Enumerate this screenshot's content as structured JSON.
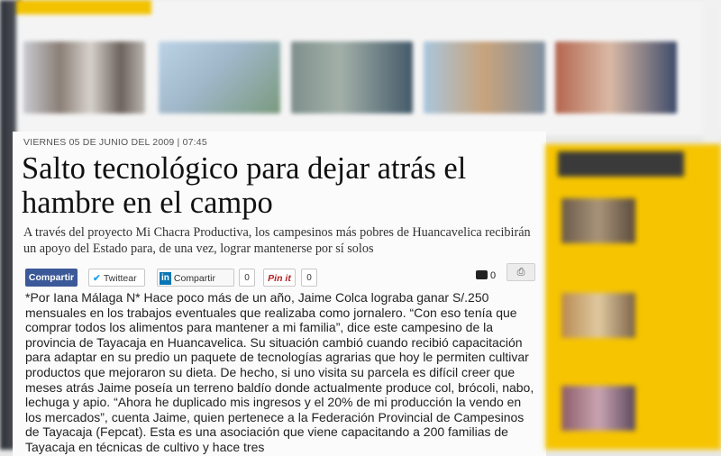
{
  "top_strip": {
    "tab_label": "",
    "thumbnails": [
      {
        "caption": "",
        "color_a": "#c9cbd0",
        "color_b": "#8a7e76"
      },
      {
        "caption": "",
        "color_a": "#bcd3e6",
        "color_b": "#7a9a7e"
      },
      {
        "caption": "",
        "color_a": "#7e8f8c",
        "color_b": "#445a6a"
      },
      {
        "caption": "",
        "color_a": "#a9c6dd",
        "color_b": "#c8a37c"
      },
      {
        "caption": "",
        "color_a": "#b46650",
        "color_b": "#3d4b6b"
      }
    ]
  },
  "article": {
    "dateline": "VIERNES 05 DE JUNIO DEL 2009 | 07:45",
    "headline": "Salto tecnológico para dejar atrás el hambre en el campo",
    "subhead": "A través del proyecto Mi Chacra Productiva, los campesinos más pobres de Huancavelica recibirán un apoyo del Estado para, de una vez, lograr mantenerse por sí solos",
    "body": "*Por Iana Málaga N* Hace poco más de un año, Jaime Colca lograba ganar S/.250 mensuales en los trabajos eventuales que realizaba como jornalero. “Con eso tenía que comprar todos los alimentos para mantener a mi familia”, dice este campesino de la provincia de Tayacaja en Huancavelica. Su situación cambió cuando recibió capacitación para adaptar en su predio un paquete de tecnologías agrarias que hoy le permiten cultivar productos que mejoraron su dieta. De hecho, si uno visita su parcela es difícil creer que meses atrás Jaime poseía un terreno baldío donde actualmente produce col, brócoli, nabo, lechuga y apio. “Ahora he duplicado mis ingresos y el 20% de mi producción la vendo en los mercados”, cuenta Jaime, quien pertenece a la Federación Provincial de Campesinos de Tayacaja (Fepcat). Esta es una asociación que viene capacitando a 200 familias de Tayacaja en técnicas de cultivo y hace tres"
  },
  "share": {
    "facebook_label": "Compartir",
    "twitter_label": "Twittear",
    "linkedin_label": "Compartir",
    "linkedin_count": "0",
    "pinterest_label": "Pin it",
    "pinterest_count": "0",
    "comment_count": "0"
  },
  "sidebar": {
    "heading": "",
    "items": [
      {
        "text": ""
      },
      {
        "text": ""
      },
      {
        "text": ""
      }
    ]
  },
  "colors": {
    "accent_yellow": "#f6c400",
    "facebook_blue": "#3b5998",
    "linkedin_blue": "#0a76b4",
    "pinterest_red": "#b81e22"
  }
}
